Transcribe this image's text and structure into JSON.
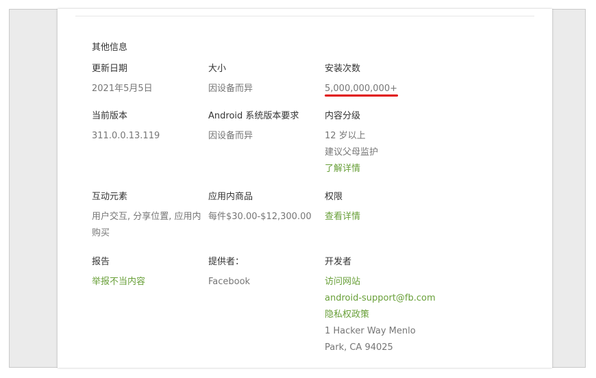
{
  "section_title": "其他信息",
  "fields": {
    "updated": {
      "label": "更新日期",
      "value": "2021年5月5日"
    },
    "size": {
      "label": "大小",
      "value": "因设备而异"
    },
    "installs": {
      "label": "安装次数",
      "value": "5,000,000,000+"
    },
    "current_version": {
      "label": "当前版本",
      "value": "311.0.0.13.119"
    },
    "android_req": {
      "label": "Android 系统版本要求",
      "value": "因设备而异"
    },
    "content_rating": {
      "label": "内容分级",
      "line1": "12 岁以上",
      "line2": "建议父母监护",
      "link": "了解详情"
    },
    "interactive": {
      "label": "互动元素",
      "value": "用户交互, 分享位置, 应用内购买"
    },
    "in_app": {
      "label": "应用内商品",
      "value": "每件$30.00-$12,300.00"
    },
    "permissions": {
      "label": "权限",
      "link": "查看详情"
    },
    "report": {
      "label": "报告",
      "link": "举报不当内容"
    },
    "offered_by": {
      "label": "提供者：",
      "value": "Facebook"
    },
    "developer": {
      "label": "开发者",
      "website": "访问网站",
      "email": "android-support@fb.com",
      "privacy": "隐私权政策",
      "address_line1": "1 Hacker Way Menlo",
      "address_line2": "Park, CA 94025"
    }
  },
  "colors": {
    "link": "#689f38",
    "label": "#333333",
    "value": "#767676",
    "highlight": "#e00000"
  }
}
